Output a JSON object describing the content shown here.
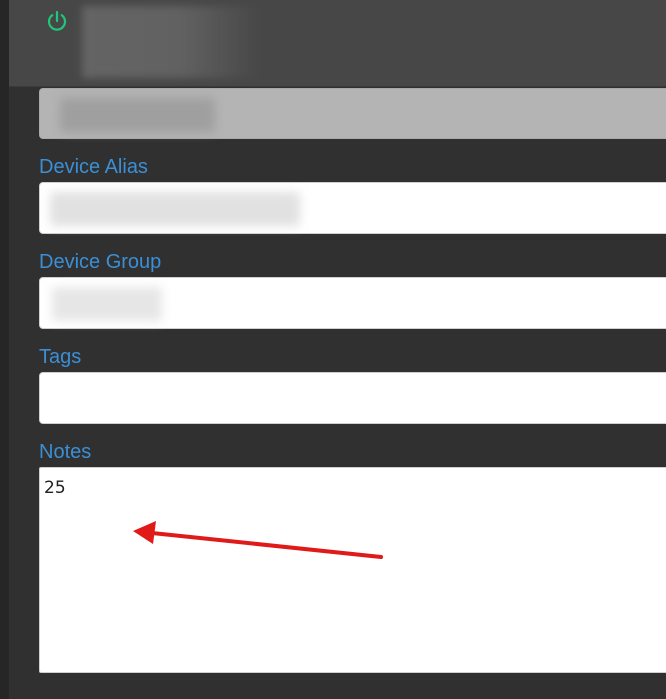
{
  "header": {
    "icon": "power-icon",
    "accent": "#20c77a"
  },
  "form": {
    "device_alias_label": "Device Alias",
    "device_group_label": "Device Group",
    "tags_label": "Tags",
    "notes_label": "Notes",
    "notes_value": "25"
  },
  "colors": {
    "label": "#3a8fd6",
    "annotation_arrow": "#e01919"
  }
}
